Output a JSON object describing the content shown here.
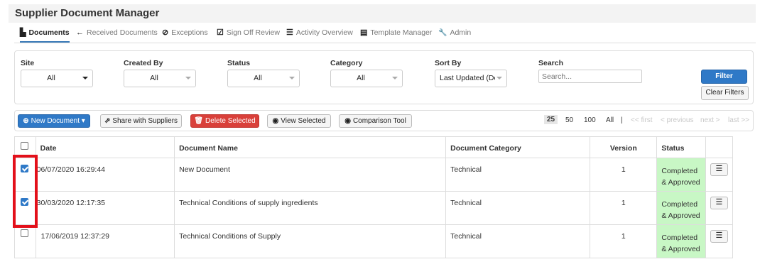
{
  "app": {
    "title": "Supplier Document Manager"
  },
  "tabs": [
    {
      "label": "Documents",
      "icon": "document-icon",
      "glyph": "▙"
    },
    {
      "label": "Received Documents",
      "icon": "arrow-left-icon",
      "glyph": "←"
    },
    {
      "label": "Exceptions",
      "icon": "check-circle-icon",
      "glyph": "⊘"
    },
    {
      "label": "Sign Off Review",
      "icon": "check-square-icon",
      "glyph": "☑"
    },
    {
      "label": "Activity Overview",
      "icon": "list-icon",
      "glyph": "☰"
    },
    {
      "label": "Template Manager",
      "icon": "table-icon",
      "glyph": "▤"
    },
    {
      "label": "Admin",
      "icon": "wrench-icon",
      "glyph": "🔧"
    }
  ],
  "filters": {
    "site": {
      "label": "Site",
      "value": "All"
    },
    "created_by": {
      "label": "Created By",
      "value": "All"
    },
    "status": {
      "label": "Status",
      "value": "All"
    },
    "category": {
      "label": "Category",
      "value": "All"
    },
    "sort_by": {
      "label": "Sort By",
      "value": "Last Updated (Desc"
    },
    "search": {
      "label": "Search",
      "placeholder": "Search..."
    },
    "filter_button": "Filter",
    "clear_button": "Clear Filters"
  },
  "toolbar": {
    "new_document": "New Document",
    "share": "Share with Suppliers",
    "delete": "Delete Selected",
    "view": "View Selected",
    "compare": "Comparison Tool"
  },
  "pager": {
    "sizes": [
      "25",
      "50",
      "100",
      "All"
    ],
    "selected_size": "25",
    "separator": "|",
    "first": "<< first",
    "previous": "< previous",
    "next": "next >",
    "last": "last >>"
  },
  "table": {
    "headers": {
      "date": "Date",
      "name": "Document Name",
      "category": "Document Category",
      "version": "Version",
      "status": "Status"
    },
    "rows": [
      {
        "checked": true,
        "date": "06/07/2020 16:29:44",
        "name": "New Document",
        "category": "Technical",
        "version": "1",
        "status_line1": "Completed",
        "status_line2": "& Approved"
      },
      {
        "checked": true,
        "date": "30/03/2020 12:17:35",
        "name": "Technical Conditions of supply ingredients",
        "category": "Technical",
        "version": "1",
        "status_line1": "Completed",
        "status_line2": "& Approved"
      },
      {
        "checked": false,
        "date": "17/06/2019 12:37:29",
        "name": "Technical Conditions of Supply",
        "category": "Technical",
        "version": "1",
        "status_line1": "Completed",
        "status_line2": "& Approved"
      }
    ]
  },
  "colors": {
    "accent": "#2f79c7",
    "danger": "#d9403a",
    "status_bg": "#c8f7c5",
    "highlight": "#e3101a"
  }
}
